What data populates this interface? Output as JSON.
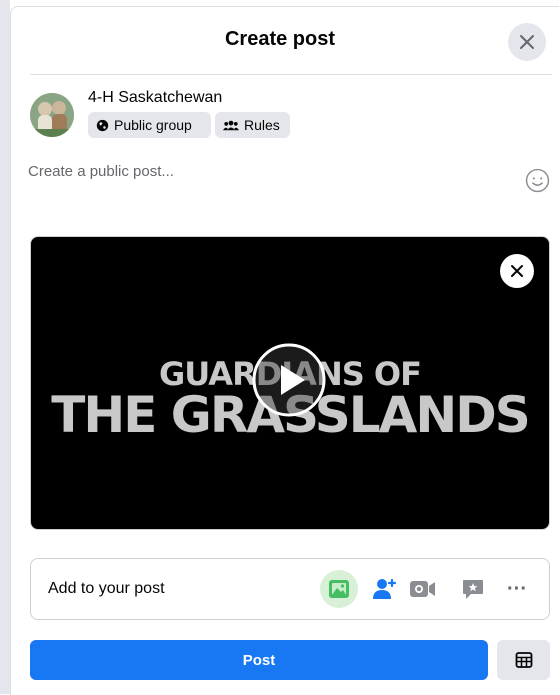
{
  "dialog": {
    "title": "Create post",
    "close_icon": "close-icon"
  },
  "author": {
    "name": "4-H Saskatchewan",
    "audience_label": "Public group",
    "audience_icon": "globe-icon",
    "rules_label": "Rules",
    "rules_icon": "people-icon"
  },
  "composer": {
    "placeholder": "Create a public post...",
    "emoji_icon": "smiley-icon"
  },
  "media": {
    "title_line1": "GUARDIANS OF",
    "title_line2": "THE GRASSLANDS",
    "play_icon": "play-icon",
    "remove_icon": "close-icon"
  },
  "add_to_post": {
    "label": "Add to your post",
    "icons": [
      "photo-video-icon",
      "tag-people-icon",
      "live-video-icon",
      "feeling-icon",
      "more-icon"
    ],
    "more_label": "···"
  },
  "footer": {
    "post_label": "Post",
    "schedule_icon": "calendar-icon"
  },
  "colors": {
    "primary": "#1877f2",
    "secondary_bg": "#e4e6eb",
    "photo_green": "#45bd62",
    "tag_blue": "#1877f2",
    "muted_icon": "#65676b"
  }
}
